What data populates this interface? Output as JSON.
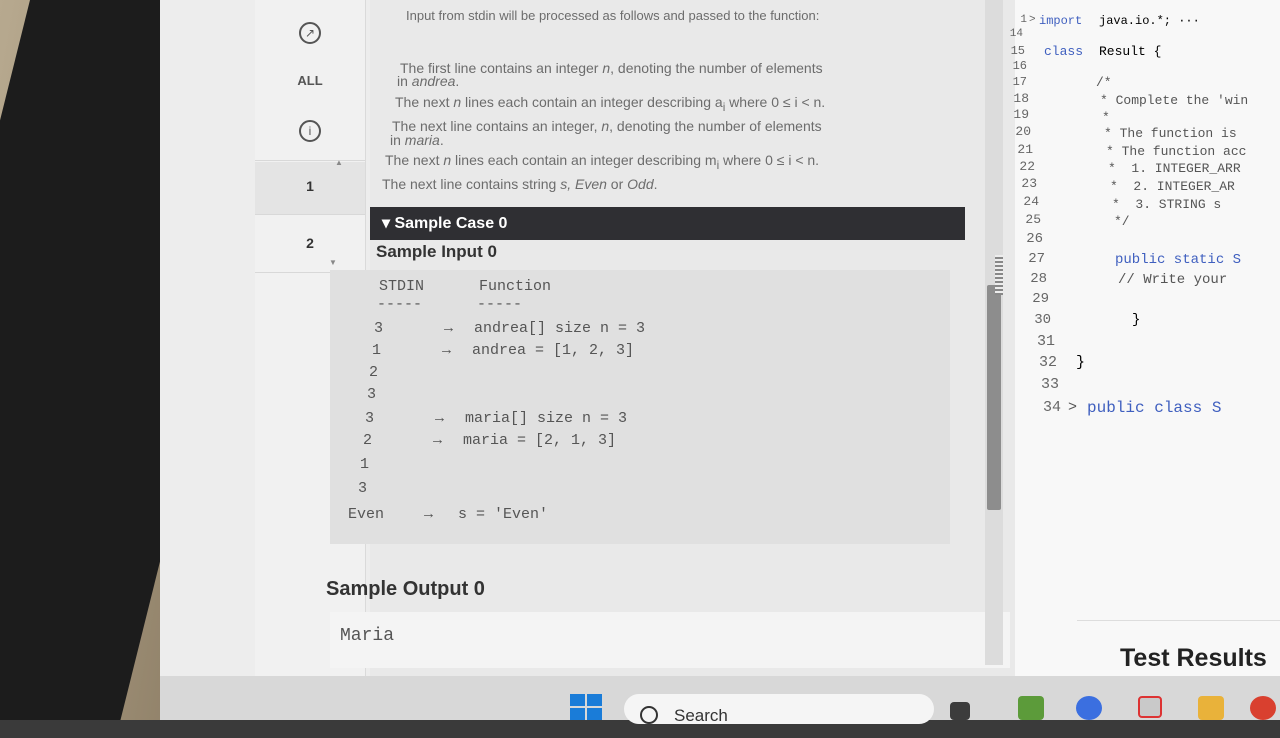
{
  "rail": {
    "all_label": "ALL",
    "problems": [
      "1",
      "2"
    ]
  },
  "problem": {
    "intro": "Input from stdin will be processed as follows and passed to the function:",
    "lines": [
      {
        "pre": "The first line contains an integer ",
        "var": "n",
        "post": ", denoting the number of elements"
      },
      {
        "pre": "in ",
        "var": "andrea",
        "post": "."
      },
      {
        "pre": "The next ",
        "var": "n",
        "post": " lines each contain an integer describing a",
        "sub": "i",
        "post2": " where 0 ≤ i < n."
      },
      {
        "pre": "The next line contains an integer, ",
        "var": "n",
        "post": ", denoting the number of elements"
      },
      {
        "pre": "in ",
        "var": "maria",
        "post": "."
      },
      {
        "pre": "The next ",
        "var": "n",
        "post": " lines each contain an integer describing m",
        "sub": "i",
        "post2": " where 0 ≤ i < n."
      },
      {
        "pre": "The next line contains string ",
        "var": "s, Even",
        "post": " or ",
        "var2": "Odd",
        "post2": "."
      }
    ],
    "sample_case_label": "Sample Case 0",
    "sample_input_title": "Sample Input 0",
    "stdin_header": "STDIN",
    "function_header": "Function",
    "dashes": "-----",
    "rows": [
      {
        "stdin": "3",
        "arrow": "→",
        "func": "andrea[] size n = 3"
      },
      {
        "stdin": "1",
        "arrow": "→",
        "func": "andrea = [1, 2, 3]"
      },
      {
        "stdin": "2",
        "arrow": "",
        "func": ""
      },
      {
        "stdin": "3",
        "arrow": "",
        "func": ""
      },
      {
        "stdin": "3",
        "arrow": "→",
        "func": "maria[] size n = 3"
      },
      {
        "stdin": "2",
        "arrow": "→",
        "func": "maria = [2, 1, 3]"
      },
      {
        "stdin": "1",
        "arrow": "",
        "func": ""
      },
      {
        "stdin": "3",
        "arrow": "",
        "func": ""
      },
      {
        "stdin": "Even",
        "arrow": "→",
        "func": "s = 'Even'"
      }
    ],
    "sample_output_title": "Sample Output 0",
    "sample_output_value": "Maria"
  },
  "editor": {
    "line_numbers": [
      "1",
      "14",
      "15",
      "16",
      "17",
      "18",
      "19",
      "20",
      "21",
      "22",
      "23",
      "24",
      "25",
      "26",
      "27",
      "28",
      "29",
      "30",
      "31",
      "32",
      "33",
      "34"
    ],
    "code": {
      "import_kw": "import",
      "import_rest": "java.io.*; ···",
      "class_kw": "class",
      "class_rest": "Result {",
      "c1": "/*",
      "c2": "* Complete the 'win",
      "c3": "*",
      "c4": "* The function is",
      "c5": "* The function acc",
      "c6": "*  1. INTEGER_ARR",
      "c7": "*  2. INTEGER_AR",
      "c8": "*  3. STRING s",
      "c9": "*/",
      "method_kw": "public static S",
      "todo": "// Write your",
      "brace1": "}",
      "brace2": "}",
      "last_kw": "public class S"
    },
    "fold_markers": [
      ">",
      ">"
    ],
    "test_results": "Test Results"
  },
  "taskbar": {
    "search_placeholder": "Search"
  },
  "colors": {
    "accent": "#1a7cd8",
    "code_keyword": "#3f5fbf",
    "case_bar": "#2f2f33"
  }
}
